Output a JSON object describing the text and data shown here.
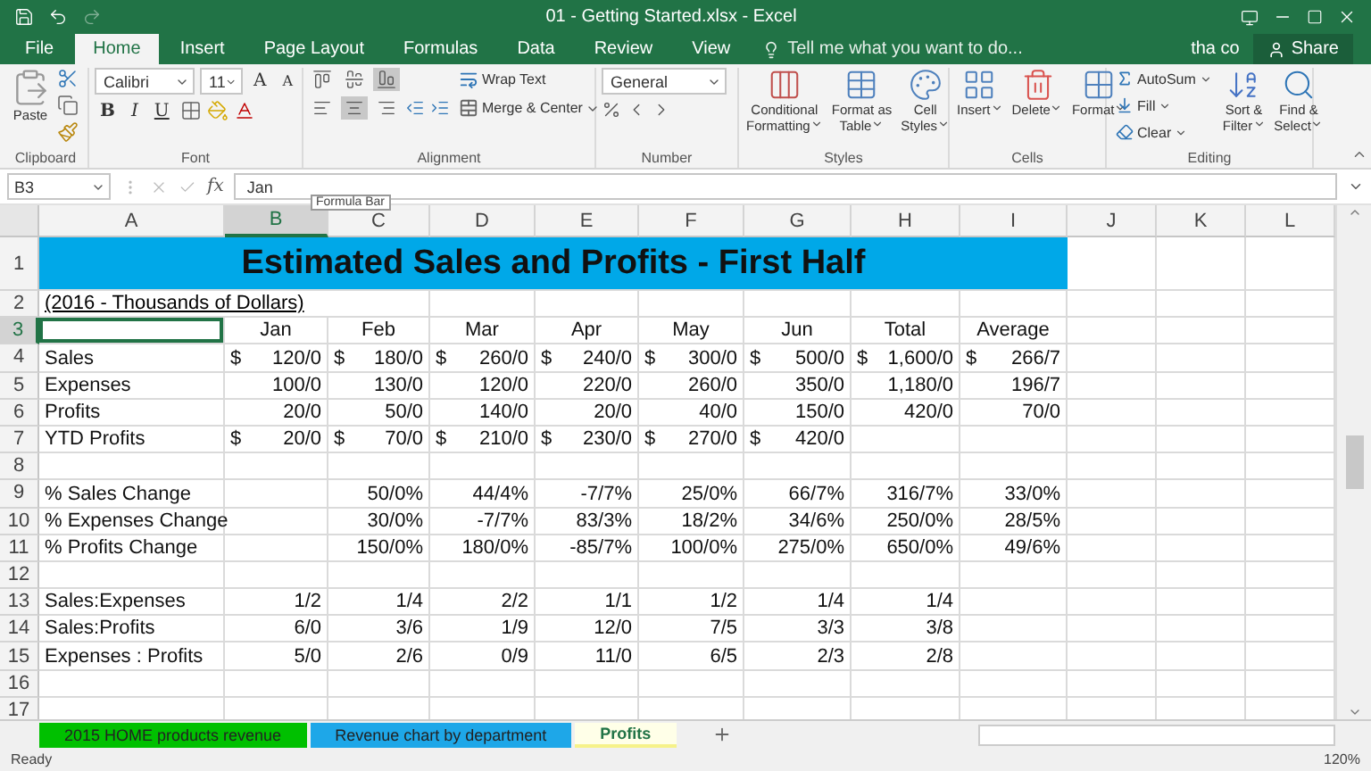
{
  "window": {
    "title": "01 - Getting Started.xlsx - Excel"
  },
  "ribbon_tabs": [
    {
      "label": "File",
      "selected": false
    },
    {
      "label": "Home",
      "selected": true
    },
    {
      "label": "Insert",
      "selected": false
    },
    {
      "label": "Page Layout",
      "selected": false
    },
    {
      "label": "Formulas",
      "selected": false
    },
    {
      "label": "Data",
      "selected": false
    },
    {
      "label": "Review",
      "selected": false
    },
    {
      "label": "View",
      "selected": false
    }
  ],
  "tell_me": "Tell me what you want to do...",
  "user": "tha co",
  "share": "Share",
  "clipboard": {
    "paste": "Paste",
    "label": "Clipboard"
  },
  "font": {
    "name": "Calibri",
    "size": "11",
    "grow": "A",
    "shrink": "A",
    "styles": [
      "B",
      "I",
      "U"
    ],
    "label": "Font"
  },
  "alignment": {
    "vertical": [
      {
        "kind": "top",
        "selected": false
      },
      {
        "kind": "middle",
        "selected": false
      },
      {
        "kind": "bottom",
        "selected": true
      }
    ],
    "horizontal": [
      {
        "kind": "left",
        "selected": false
      },
      {
        "kind": "center",
        "selected": true
      },
      {
        "kind": "right",
        "selected": false
      }
    ],
    "wrap": "Wrap Text",
    "merge": "Merge & Center",
    "label": "Alignment"
  },
  "number": {
    "format": "General",
    "label": "Number"
  },
  "styles": {
    "buttons": [
      {
        "kind": "conditional",
        "lines": [
          "Conditional",
          "Formatting"
        ]
      },
      {
        "kind": "table",
        "lines": [
          "Format as",
          "Table"
        ]
      },
      {
        "kind": "cell",
        "lines": [
          "Cell",
          "Styles"
        ]
      }
    ],
    "label": "Styles"
  },
  "cells": {
    "buttons": [
      {
        "kind": "insert",
        "lines": [
          "Insert"
        ]
      },
      {
        "kind": "delete",
        "lines": [
          "Delete"
        ]
      },
      {
        "kind": "format",
        "lines": [
          "Format"
        ]
      }
    ],
    "label": "Cells"
  },
  "editing": {
    "small": [
      {
        "kind": "autosum",
        "label": "AutoSum"
      },
      {
        "kind": "fill",
        "label": "Fill"
      },
      {
        "kind": "clear",
        "label": "Clear"
      }
    ],
    "buttons": [
      {
        "kind": "sort",
        "lines": [
          "Sort &",
          "Filter"
        ]
      },
      {
        "kind": "find",
        "lines": [
          "Find &",
          "Select"
        ]
      }
    ],
    "label": "Editing"
  },
  "formula_bar": {
    "name_box": "B3",
    "function_label": "fx",
    "value": "Jan",
    "tooltip": "Formula Bar"
  },
  "columns": [
    {
      "label": "A",
      "selected": false
    },
    {
      "label": "B",
      "selected": true
    },
    {
      "label": "C",
      "selected": false
    },
    {
      "label": "D",
      "selected": false
    },
    {
      "label": "E",
      "selected": false
    },
    {
      "label": "F",
      "selected": false
    },
    {
      "label": "G",
      "selected": false
    },
    {
      "label": "H",
      "selected": false
    },
    {
      "label": "I",
      "selected": false
    },
    {
      "label": "J",
      "selected": false
    },
    {
      "label": "K",
      "selected": false
    },
    {
      "label": "L",
      "selected": false
    }
  ],
  "rows": [
    {
      "label": "1",
      "selected": false,
      "kind": "title",
      "text": "Estimated Sales and Profits - First Half"
    },
    {
      "label": "2",
      "selected": false,
      "kind": "note",
      "text": "(2016 - Thousands of Dollars)"
    },
    {
      "label": "3",
      "selected": true,
      "kind": "header",
      "cells": [
        null,
        "Jan",
        "Feb",
        "Mar",
        "Apr",
        "May",
        "Jun",
        "Total",
        "Average"
      ]
    },
    {
      "label": "4",
      "selected": false,
      "kind": "data",
      "cells": [
        "Sales",
        {
          "currency": "$",
          "value": "120/0"
        },
        {
          "currency": "$",
          "value": "180/0"
        },
        {
          "currency": "$",
          "value": "260/0"
        },
        {
          "currency": "$",
          "value": "240/0"
        },
        {
          "currency": "$",
          "value": "300/0"
        },
        {
          "currency": "$",
          "value": "500/0"
        },
        {
          "currency": "$",
          "value": "1,600/0"
        },
        {
          "currency": "$",
          "value": "266/7"
        }
      ]
    },
    {
      "label": "5",
      "selected": false,
      "kind": "data",
      "cells": [
        "Expenses",
        "100/0",
        "130/0",
        "120/0",
        "220/0",
        "260/0",
        "350/0",
        "1,180/0",
        "196/7"
      ]
    },
    {
      "label": "6",
      "selected": false,
      "kind": "data",
      "cells": [
        "Profits",
        "20/0",
        "50/0",
        "140/0",
        "20/0",
        "40/0",
        "150/0",
        "420/0",
        "70/0"
      ]
    },
    {
      "label": "7",
      "selected": false,
      "kind": "data",
      "cells": [
        "YTD Profits",
        {
          "currency": "$",
          "value": "20/0"
        },
        {
          "currency": "$",
          "value": "70/0"
        },
        {
          "currency": "$",
          "value": "210/0"
        },
        {
          "currency": "$",
          "value": "230/0"
        },
        {
          "currency": "$",
          "value": "270/0"
        },
        {
          "currency": "$",
          "value": "420/0"
        },
        null,
        null
      ]
    },
    {
      "label": "8",
      "selected": false,
      "kind": "data",
      "cells": []
    },
    {
      "label": "9",
      "selected": false,
      "kind": "data",
      "cells": [
        "% Sales Change",
        null,
        "50/0%",
        "44/4%",
        "-7/7%",
        "25/0%",
        "66/7%",
        "316/7%",
        "33/0%"
      ]
    },
    {
      "label": "10",
      "selected": false,
      "kind": "data",
      "cells": [
        "% Expenses Change",
        null,
        "30/0%",
        "-7/7%",
        "83/3%",
        "18/2%",
        "34/6%",
        "250/0%",
        "28/5%"
      ]
    },
    {
      "label": "11",
      "selected": false,
      "kind": "data",
      "cells": [
        "% Profits Change",
        null,
        "150/0%",
        "180/0%",
        "-85/7%",
        "100/0%",
        "275/0%",
        "650/0%",
        "49/6%"
      ]
    },
    {
      "label": "12",
      "selected": false,
      "kind": "data",
      "cells": []
    },
    {
      "label": "13",
      "selected": false,
      "kind": "data",
      "cells": [
        "Sales:Expenses",
        "1/2",
        "1/4",
        "2/2",
        "1/1",
        "1/2",
        "1/4",
        "1/4",
        null
      ]
    },
    {
      "label": "14",
      "selected": false,
      "kind": "data",
      "cells": [
        "Sales:Profits",
        "6/0",
        "3/6",
        "1/9",
        "12/0",
        "7/5",
        "3/3",
        "3/8",
        null
      ]
    },
    {
      "label": "15",
      "selected": false,
      "kind": "data",
      "cells": [
        "Expenses :  Profits",
        "5/0",
        "2/6",
        "0/9",
        "11/0",
        "6/5",
        "2/3",
        "2/8",
        null
      ]
    },
    {
      "label": "16",
      "selected": false,
      "kind": "data",
      "cells": []
    },
    {
      "label": "17",
      "selected": false,
      "kind": "data",
      "cells": []
    }
  ],
  "sheet_tabs": [
    {
      "label": "2015 HOME products revenue",
      "color": "#00c000",
      "selected": false
    },
    {
      "label": "Revenue chart by department",
      "color": "#1ea7e8",
      "selected": false
    },
    {
      "label": "Profits",
      "color": "#f6f28a",
      "selected": true
    }
  ],
  "status": {
    "text": "Ready",
    "zoom": "120%"
  }
}
